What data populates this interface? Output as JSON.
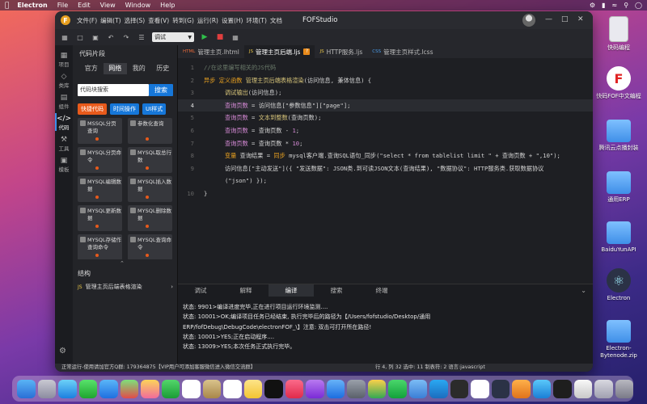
{
  "menubar": {
    "app_name": "Electron",
    "items": [
      "File",
      "Edit",
      "View",
      "Window",
      "Help"
    ]
  },
  "desktop": {
    "icons": [
      {
        "label": "快码编程",
        "kind": "doc"
      },
      {
        "label": "快码FOF中文编程",
        "kind": "logo"
      },
      {
        "label": "腾讯云点播封装",
        "kind": "folder"
      },
      {
        "label": "通用ERP",
        "kind": "folder"
      },
      {
        "label": "BaiduYunAPI",
        "kind": "folder"
      },
      {
        "label": "Electron",
        "kind": "electron"
      },
      {
        "label": "Electron-Bytenode.zip",
        "kind": "folder"
      }
    ]
  },
  "window": {
    "title": "FOFStudio",
    "menus": [
      "文件(F)",
      "编辑(T)",
      "选择(S)",
      "查看(V)",
      "转到(G)",
      "运行(R)",
      "设置(H)",
      "环境(T)",
      "文档"
    ]
  },
  "toolbar": {
    "mode": "调试"
  },
  "activity": [
    {
      "icon": "items-icon",
      "label": "项目"
    },
    {
      "icon": "class-icon",
      "label": "类库"
    },
    {
      "icon": "component-icon",
      "label": "组件"
    },
    {
      "icon": "code-icon",
      "label": "代码",
      "active": true
    },
    {
      "icon": "tool-icon",
      "label": "工具"
    },
    {
      "icon": "template-icon",
      "label": "模板"
    }
  ],
  "snippets": {
    "title": "代码片段",
    "tabs": [
      "官方",
      "网络",
      "我的",
      "历史"
    ],
    "active_tab": "网络",
    "search_value": "代码块搜索",
    "search_btn": "搜索",
    "chips": [
      {
        "label": "快捷代码",
        "color": "#e85a1b"
      },
      {
        "label": "时间操作",
        "color": "#1677d9"
      },
      {
        "label": "UI样式",
        "color": "#1677d9"
      }
    ],
    "cards": [
      {
        "label": "MSSQL分页查询"
      },
      {
        "label": "参数化查询"
      },
      {
        "label": "MYSQL分页命令"
      },
      {
        "label": "MYSQL取总行数"
      },
      {
        "label": "MYSQL编辑数据"
      },
      {
        "label": "MYSQL插入数据"
      },
      {
        "label": "MYSQL更新数据"
      },
      {
        "label": "MYSQL删除数据"
      },
      {
        "label": "MYSQL存储作查询命令"
      },
      {
        "label": "MYSQL查询命令"
      }
    ],
    "structure_title": "结构",
    "structure_item": "管理主页后端表格渲染",
    "structure_badge": "JS"
  },
  "editor": {
    "tabs": [
      {
        "label": "管理主页.lhtml",
        "type": "HTML",
        "active": false
      },
      {
        "label": "管理主页后端.ljs",
        "type": "JS",
        "active": true,
        "modified": true
      },
      {
        "label": "HTTP服务.ljs",
        "type": "JS",
        "active": false
      },
      {
        "label": "管理主页样式.lcss",
        "type": "CSS",
        "active": false
      }
    ],
    "lines": [
      {
        "n": "1",
        "segs": [
          [
            "com",
            "//在这里编写相关的JS代码"
          ]
        ]
      },
      {
        "n": "2",
        "segs": [
          [
            "kw",
            "异步 "
          ],
          [
            "kw",
            "定义函数 "
          ],
          [
            "fn",
            "管理主页后端表格渲染"
          ],
          [
            "plain",
            "(访问信息, 兼体信息) {"
          ]
        ]
      },
      {
        "n": "3",
        "segs": [
          [
            "plain",
            "      "
          ],
          [
            "fn",
            "调试输出"
          ],
          [
            "plain",
            "(访问信息);"
          ]
        ]
      },
      {
        "n": "4",
        "hl": true,
        "segs": [
          [
            "plain",
            "      "
          ],
          [
            "var",
            "查询页数"
          ],
          [
            "plain",
            " = 访问信息[\"参数信息\"][\"page\"];"
          ]
        ]
      },
      {
        "n": "5",
        "segs": [
          [
            "plain",
            "      "
          ],
          [
            "var",
            "查询页数"
          ],
          [
            "plain",
            " = "
          ],
          [
            "fn",
            "文本到整数"
          ],
          [
            "plain",
            "(查询页数);"
          ]
        ]
      },
      {
        "n": "6",
        "segs": [
          [
            "plain",
            "      "
          ],
          [
            "var",
            "查询页数"
          ],
          [
            "plain",
            " = 查询页数 - "
          ],
          [
            "num",
            "1"
          ],
          [
            "plain",
            ";"
          ]
        ]
      },
      {
        "n": "7",
        "segs": [
          [
            "plain",
            "      "
          ],
          [
            "var",
            "查询页数"
          ],
          [
            "plain",
            " = 查询页数 * "
          ],
          [
            "num",
            "10"
          ],
          [
            "plain",
            ";"
          ]
        ]
      },
      {
        "n": "8",
        "segs": [
          [
            "plain",
            "      "
          ],
          [
            "kw",
            "变量 "
          ],
          [
            "plain",
            "查询结果 = "
          ],
          [
            "kw",
            "同步 "
          ],
          [
            "plain",
            "mysql客户端.查询SQL语句_同步(\"select * from tablelist limit \" + 查询页数 + \",10\");"
          ]
        ]
      },
      {
        "n": "9",
        "segs": [
          [
            "plain",
            "      "
          ],
          [
            "plain",
            "访问信息[\"主动发送\"]({ \"发送数据\": JSON类.到可读JSON文本(查询结果), \"数据协议\": HTTP服务类.获取数据协议"
          ]
        ]
      },
      {
        "n": "",
        "segs": [
          [
            "plain",
            "      (\"json\") });"
          ]
        ]
      },
      {
        "n": "10",
        "segs": [
          [
            "plain",
            "}"
          ]
        ]
      }
    ]
  },
  "bottom": {
    "tabs": [
      "调试",
      "解释",
      "编译",
      "搜索",
      "终端"
    ],
    "active_tab": "编译",
    "logs": [
      "状态: 9901>编译进度完毕,正在进行项目运行环境监测....",
      "状态: 10001>OK;编译项目任务已经结束, 执行完毕后的路径为【/Users/fofstudio/Desktop/通用",
      "ERP/fofDebug\\DebugCode\\electronFOF_\\】注意: 双击可打开所在路径!",
      "状态: 10001>YES;正在启动程序....",
      "状态: 13009>YES;本次任务正式执行完毕。"
    ]
  },
  "status": {
    "left": "正常运行-使用请加官方Q群: 179364875【VIP用户可添加客服微信进入微信交流群】",
    "right": "行 4, 列 32    选中: 11    制表符: 2    语言:javascript"
  }
}
